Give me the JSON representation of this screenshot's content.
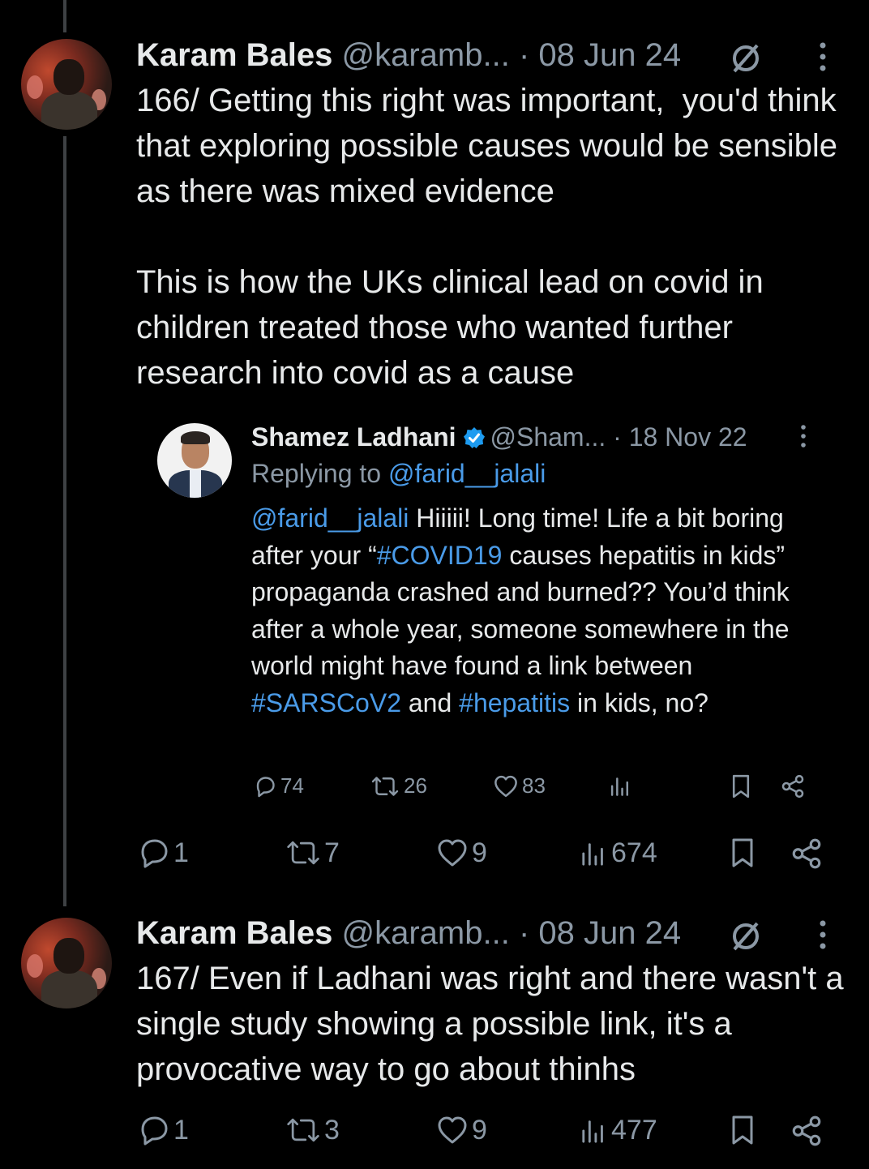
{
  "colors": {
    "background": "#000000",
    "text": "#e7e9ea",
    "muted": "#8b98a5",
    "link": "#4a9be8",
    "thread_line": "#3e4144"
  },
  "tweet1": {
    "name": "Karam Bales",
    "handle": "@karamb...",
    "date": "· 08 Jun 24",
    "text": "166/ Getting this right was important,  you'd think that exploring possible causes would be sensible as there was mixed evidence\n\nThis is how the UKs clinical lead on covid in children treated those who wanted further research into covid as a cause",
    "replies": "1",
    "reposts": "7",
    "likes": "9",
    "views": "674"
  },
  "quoted": {
    "name": "Shamez Ladhani",
    "handle": "@Sham...",
    "date": "· 18 Nov 22",
    "replying_prefix": "Replying to ",
    "replying_to": "@farid__jalali",
    "text_parts": {
      "mention": "@farid__jalali",
      "t1": " Hiiiii! Long time! Life a bit boring after your “",
      "tag1": "#COVID19",
      "t2": " causes hepatitis in kids” propaganda crashed and burned?? You’d think after a whole year, someone somewhere in the world might have found a link between ",
      "tag2": "#SARSCoV2",
      "t3": " and ",
      "tag3": "#hepatitis",
      "t4": " in kids, no?"
    },
    "replies": "74",
    "reposts": "26",
    "likes": "83"
  },
  "tweet2": {
    "name": "Karam Bales",
    "handle": "@karamb...",
    "date": "· 08 Jun 24",
    "text": "167/ Even if Ladhani was right and there wasn't a single study showing a possible link, it's a provocative way to go about thinhs",
    "replies": "1",
    "reposts": "3",
    "likes": "9",
    "views": "477"
  },
  "icons": [
    "reply-icon",
    "repost-icon",
    "like-icon",
    "views-icon",
    "bookmark-icon",
    "share-icon",
    "verified-icon",
    "no-edit-icon",
    "more-icon"
  ]
}
